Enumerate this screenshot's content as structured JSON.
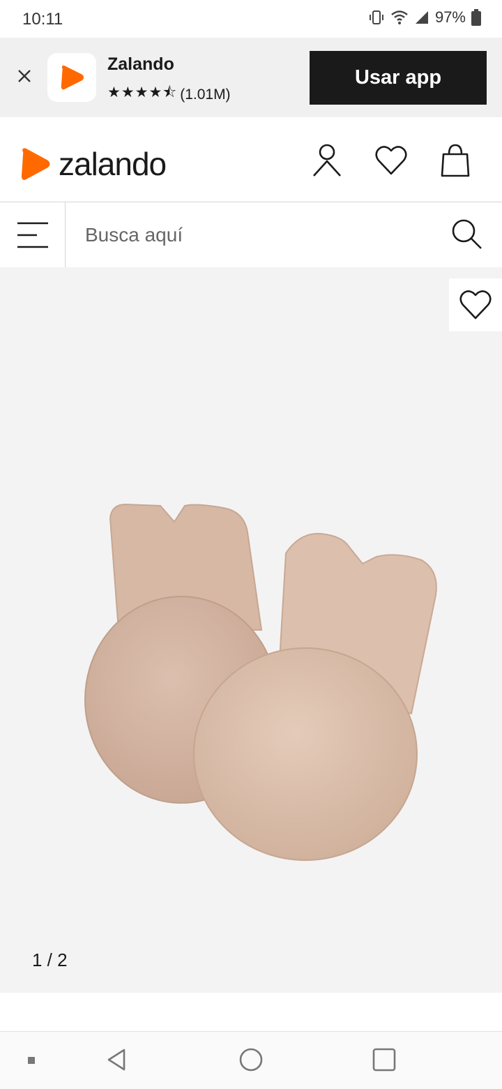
{
  "status_bar": {
    "time": "10:11",
    "battery": "97%",
    "icons": [
      "vibrate-icon",
      "wifi-icon",
      "signal-icon",
      "battery-icon"
    ]
  },
  "app_banner": {
    "app_name": "Zalando",
    "stars": "★★★★⯪",
    "rating_count": "(1.01M)",
    "cta_label": "Usar app"
  },
  "header": {
    "brand": "zalando",
    "icons": [
      "account-icon",
      "heart-icon",
      "bag-icon"
    ]
  },
  "search": {
    "placeholder": "Busca aquí"
  },
  "gallery": {
    "counter": "1 / 2"
  },
  "colors": {
    "brand_orange": "#ff6900",
    "banner_bg": "#f0f0f0",
    "cta_bg": "#1a1a1a",
    "gallery_bg": "#f3f3f4",
    "product": "#d9b8a4"
  }
}
